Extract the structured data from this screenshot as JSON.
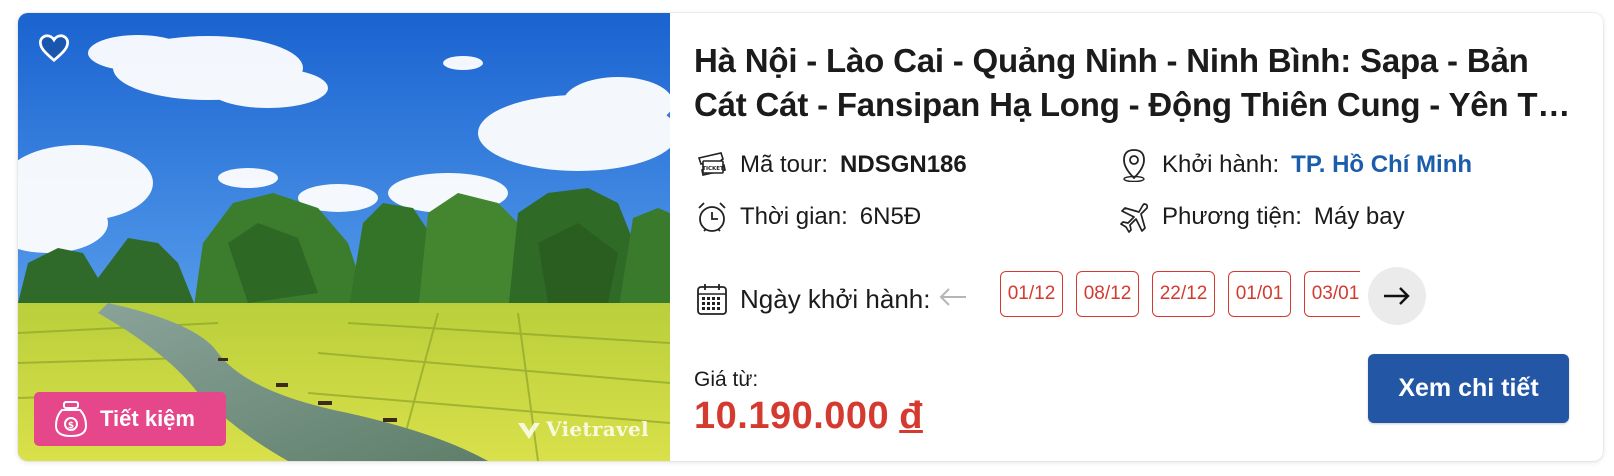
{
  "tour": {
    "title": "Hà Nội - Lào Cai - Quảng Ninh - Ninh Bình: Sapa - Bản Cát Cát - Fansipan Hạ Long - Động Thiên Cung - Yên Tử - K...",
    "badge_label": "Tiết kiệm",
    "watermark": "Vietravel",
    "code_label": "Mã tour:",
    "code_value": "NDSGN186",
    "departure_label": "Khởi hành:",
    "departure_value": "TP. Hồ Chí Minh",
    "duration_label": "Thời gian:",
    "duration_value": "6N5Đ",
    "transport_label": "Phương tiện:",
    "transport_value": "Máy bay",
    "dates_label": "Ngày khởi hành:",
    "dates": [
      "01/12",
      "08/12",
      "22/12",
      "01/01",
      "03/01"
    ],
    "price_label": "Giá từ:",
    "price_value": "10.190.000",
    "price_currency": "đ",
    "cta_label": "Xem chi tiết"
  },
  "colors": {
    "accent_blue": "#2456a6",
    "price_red": "#d43a2f",
    "badge_pink": "#e5478a",
    "link_blue": "#1c5dab"
  },
  "icons": {
    "favorite": "heart-outline-icon",
    "badge": "piggy-jar-icon",
    "code": "ticket-icon",
    "departure": "map-pin-icon",
    "duration": "alarm-clock-icon",
    "transport": "airplane-icon",
    "dates": "calendar-icon",
    "prev": "arrow-left-icon",
    "next": "arrow-right-icon"
  }
}
